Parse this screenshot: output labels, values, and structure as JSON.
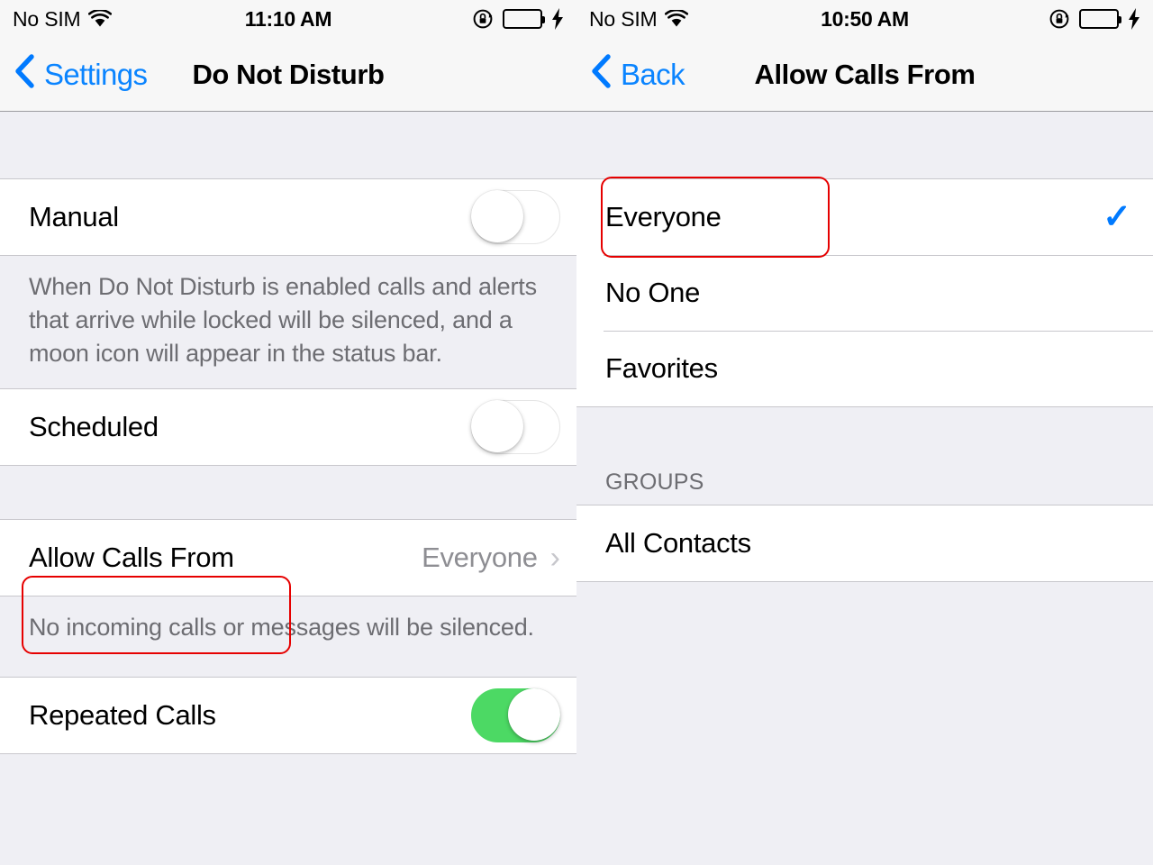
{
  "left_screen": {
    "status_bar": {
      "carrier": "No SIM",
      "wifi_icon": "wifi-icon",
      "time": "11:10 AM",
      "rotation_lock_icon": "rotation-lock-icon",
      "battery_icon": "battery-icon",
      "charging_icon": "lightning-bolt-icon",
      "battery_color": "#4cd964"
    },
    "nav": {
      "back_icon": "chevron-left-icon",
      "back_label": "Settings",
      "title": "Do Not Disturb"
    },
    "rows": {
      "manual_label": "Manual",
      "manual_state": "off",
      "manual_footer": "When Do Not Disturb is enabled calls and alerts that arrive while locked will be silenced, and a moon icon will appear in the status bar.",
      "scheduled_label": "Scheduled",
      "scheduled_state": "off",
      "allow_calls_label": "Allow Calls From",
      "allow_calls_value": "Everyone",
      "allow_calls_chevron": "chevron-right-icon",
      "allow_calls_footer": "No incoming calls or messages will be silenced.",
      "repeated_calls_label": "Repeated Calls",
      "repeated_calls_state": "on"
    },
    "highlight_color": "#e60000"
  },
  "right_screen": {
    "status_bar": {
      "carrier": "No SIM",
      "wifi_icon": "wifi-icon",
      "time": "10:50 AM",
      "rotation_lock_icon": "rotation-lock-icon",
      "battery_icon": "battery-icon",
      "charging_icon": "lightning-bolt-icon",
      "battery_color": "#4cd964"
    },
    "nav": {
      "back_icon": "chevron-left-icon",
      "back_label": "Back",
      "title": "Allow Calls From"
    },
    "options": {
      "everyone_label": "Everyone",
      "everyone_checkmark": "✓",
      "no_one_label": "No One",
      "favorites_label": "Favorites"
    },
    "groups": {
      "header": "GROUPS",
      "all_contacts_label": "All Contacts"
    },
    "highlight_color": "#e60000"
  }
}
